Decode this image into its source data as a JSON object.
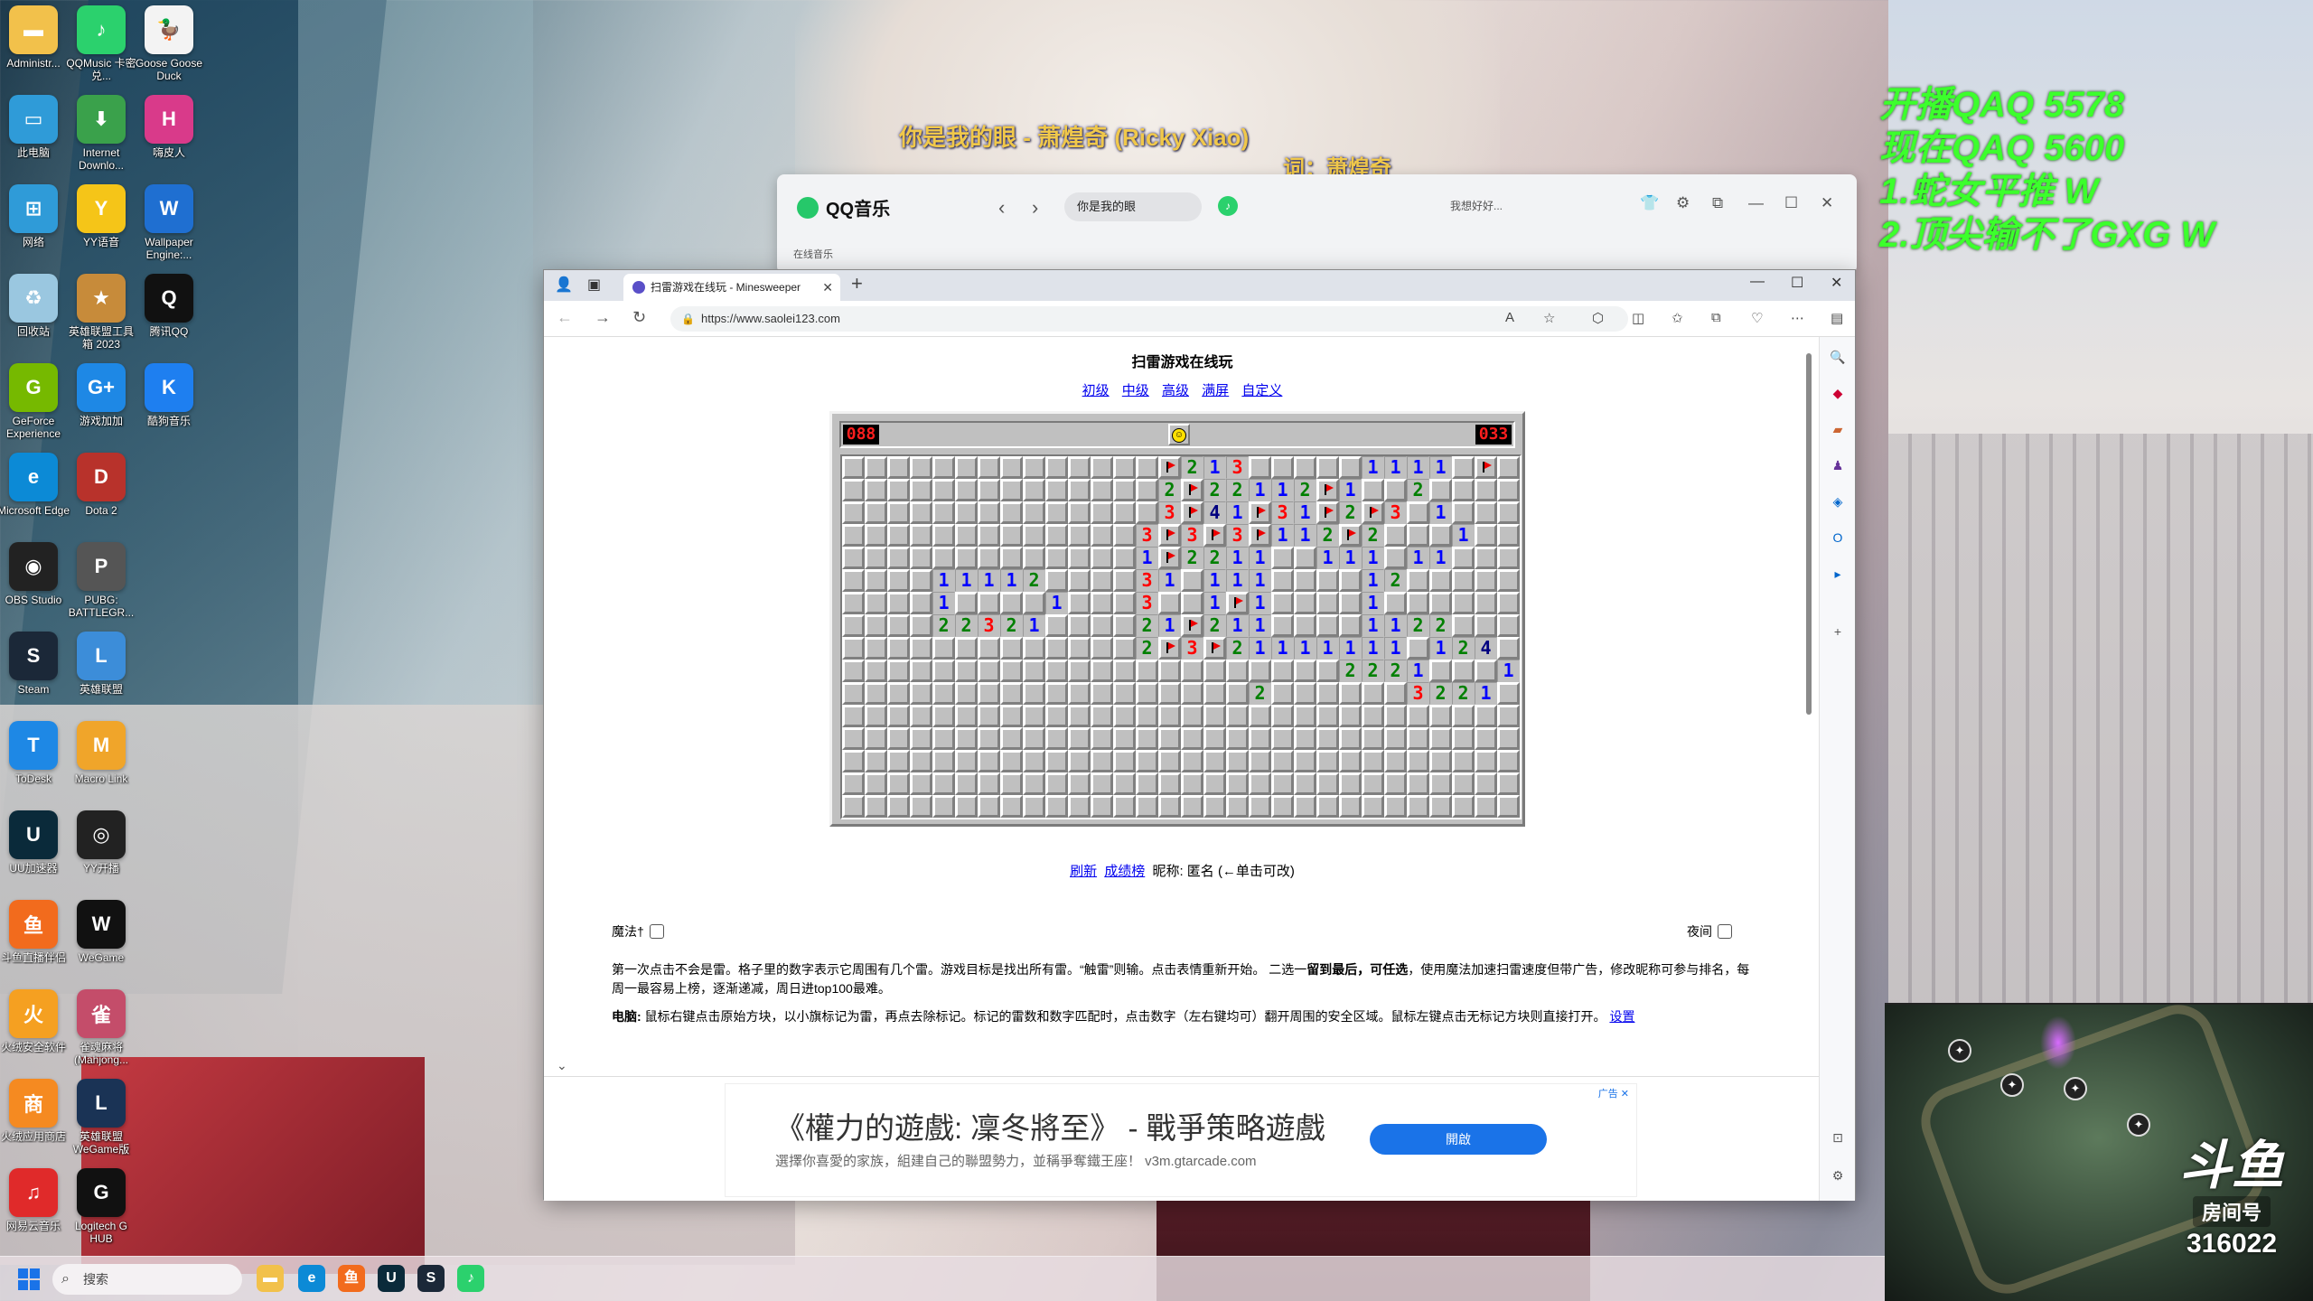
{
  "desktop": {
    "icons": [
      {
        "label": "Administr...",
        "icon": "folder-icon",
        "color": "#f2c14b",
        "glyph": "▬"
      },
      {
        "label": "QQMusic 卡密兑...",
        "icon": "qqmusic-icon",
        "color": "#2bd16d",
        "glyph": "♪"
      },
      {
        "label": "Goose Goose Duck",
        "icon": "goose-icon",
        "color": "#f3f3f3",
        "glyph": "🦆"
      },
      {
        "label": "此电脑",
        "icon": "computer-icon",
        "color": "#2f9bd8",
        "glyph": "▭"
      },
      {
        "label": "Internet Downlo...",
        "icon": "idm-icon",
        "color": "#3aa14b",
        "glyph": "⬇"
      },
      {
        "label": "嗨皮人",
        "icon": "game-icon",
        "color": "#d93a8a",
        "glyph": "H"
      },
      {
        "label": "网络",
        "icon": "network-icon",
        "color": "#2f9bd8",
        "glyph": "⊞"
      },
      {
        "label": "YY语音",
        "icon": "yy-icon",
        "color": "#f5c518",
        "glyph": "Y"
      },
      {
        "label": "Wallpaper Engine:...",
        "icon": "wallpaper-engine-icon",
        "color": "#1f6fd1",
        "glyph": "W"
      },
      {
        "label": "回收站",
        "icon": "recycle-bin-icon",
        "color": "#9ac7e0",
        "glyph": "♻"
      },
      {
        "label": "英雄联盟工具箱 2023",
        "icon": "lol-toolbox-icon",
        "color": "#c78b3a",
        "glyph": "★"
      },
      {
        "label": "腾讯QQ",
        "icon": "qq-icon",
        "color": "#111111",
        "glyph": "Q"
      },
      {
        "label": "GeForce Experience",
        "icon": "geforce-icon",
        "color": "#76b900",
        "glyph": "G"
      },
      {
        "label": "游戏加加",
        "icon": "game-plus-icon",
        "color": "#1e88e5",
        "glyph": "G+"
      },
      {
        "label": "酷狗音乐",
        "icon": "kugou-icon",
        "color": "#1e7ff0",
        "glyph": "K"
      },
      {
        "label": "Microsoft Edge",
        "icon": "edge-icon",
        "color": "#0c8ad6",
        "glyph": "e"
      },
      {
        "label": "Dota 2",
        "icon": "dota-icon",
        "color": "#b8322b",
        "glyph": "D"
      },
      {
        "label": "",
        "icon": "blank",
        "color": "transparent",
        "glyph": ""
      },
      {
        "label": "OBS Studio",
        "icon": "obs-icon",
        "color": "#222222",
        "glyph": "◉"
      },
      {
        "label": "PUBG: BATTLEGR...",
        "icon": "pubg-icon",
        "color": "#555555",
        "glyph": "P"
      },
      {
        "label": "",
        "icon": "blank",
        "color": "transparent",
        "glyph": ""
      },
      {
        "label": "Steam",
        "icon": "steam-icon",
        "color": "#1b2838",
        "glyph": "S"
      },
      {
        "label": "英雄联盟",
        "icon": "lol-icon",
        "color": "#3c8dd9",
        "glyph": "L"
      },
      {
        "label": "",
        "icon": "blank",
        "color": "transparent",
        "glyph": ""
      },
      {
        "label": "ToDesk",
        "icon": "todesk-icon",
        "color": "#1e88e5",
        "glyph": "T"
      },
      {
        "label": "Macro Link",
        "icon": "macro-icon",
        "color": "#f0a52a",
        "glyph": "M"
      },
      {
        "label": "",
        "icon": "blank",
        "color": "transparent",
        "glyph": ""
      },
      {
        "label": "UU加速器",
        "icon": "uu-icon",
        "color": "#0a2a3a",
        "glyph": "U"
      },
      {
        "label": "YY开播",
        "icon": "yy-live-icon",
        "color": "#222222",
        "glyph": "◎"
      },
      {
        "label": "",
        "icon": "blank",
        "color": "transparent",
        "glyph": ""
      },
      {
        "label": "斗鱼直播伴侣",
        "icon": "douyu-icon",
        "color": "#f26b1d",
        "glyph": "鱼"
      },
      {
        "label": "WeGame",
        "icon": "wegame-icon",
        "color": "#111111",
        "glyph": "W"
      },
      {
        "label": "",
        "icon": "blank",
        "color": "transparent",
        "glyph": ""
      },
      {
        "label": "火绒安全软件",
        "icon": "huorong-icon",
        "color": "#f5a021",
        "glyph": "火"
      },
      {
        "label": "雀魂麻将 (Mahjong...",
        "icon": "mahjong-icon",
        "color": "#c44d6a",
        "glyph": "雀"
      },
      {
        "label": "",
        "icon": "blank",
        "color": "transparent",
        "glyph": ""
      },
      {
        "label": "火绒应用商店",
        "icon": "store-icon",
        "color": "#f58a21",
        "glyph": "商"
      },
      {
        "label": "英雄联盟 WeGame版",
        "icon": "lol-wegame-icon",
        "color": "#1a3355",
        "glyph": "L"
      },
      {
        "label": "",
        "icon": "blank",
        "color": "transparent",
        "glyph": ""
      },
      {
        "label": "网易云音乐",
        "icon": "netease-icon",
        "color": "#e02a2a",
        "glyph": "♫"
      },
      {
        "label": "Logitech G HUB",
        "icon": "ghub-icon",
        "color": "#111111",
        "glyph": "G"
      }
    ]
  },
  "lyrics": {
    "line1": "你是我的眼 - 萧煌奇 (Ricky Xiao)",
    "line2": "词：萧煌奇"
  },
  "stream_overlay": {
    "lines": [
      "开播QAQ 5578",
      "现在QAQ 5600",
      "1.蛇女平推 W",
      "2.顶尖输不了GXG W"
    ]
  },
  "qqmusic": {
    "title": "QQ音乐",
    "search_value": "你是我的眼",
    "user": "我想好好...",
    "subnav": "在线音乐"
  },
  "browser": {
    "tab_title": "扫雷游戏在线玩 - Minesweeper",
    "url": "https://www.saolei123.com"
  },
  "page": {
    "title": "扫雷游戏在线玩",
    "levels": [
      "初级",
      "中级",
      "高级",
      "满屏",
      "自定义"
    ],
    "mine_counter": "088",
    "timer": "033",
    "face": "☺",
    "link_refresh": "刷新",
    "link_scores": "成绩榜",
    "nickname_text": "昵称: 匿名 (←单击可改)",
    "magic_label": "魔法†",
    "night_label": "夜间",
    "desc_1a": "第一次点击不会是雷。格子里的数字表示它周围有几个雷。游戏目标是找出所有雷。“触雷”则输。点击表情重新开始。 二选一",
    "desc_1b": "留到最后，可任选",
    "desc_1c": "，使用魔法加速扫雷速度但带广告，修改昵称可参与排名，每周一最容易上榜，逐渐递减，周日进top100最难。",
    "desc_2a": "电脑:",
    "desc_2b": " 鼠标右键点击原始方块，以小旗标记为雷，再点去除标记。标记的雷数和数字匹配时，点击数字（左右键均可）翻开周围的安全区域。鼠标左键点击无标记方块则直接打开。",
    "settings_link": "设置"
  },
  "ad": {
    "title": "《權力的遊戲: 凜冬將至》 - 戰爭策略遊戲",
    "subtitle": "選擇你喜愛的家族，組建自己的聯盟勢力，並稱爭奪鐵王座！ v3m.gtarcade.com",
    "button": "開啟",
    "mark": "广告 ✕"
  },
  "minesweeper": {
    "cols": 30,
    "rows": 16,
    "cells": [
      "..............#213.....1111.#.",
      "..............2#22112#1..2....",
      "..............3#41#31#2#3.1...",
      ".............3#3#3#112#2...1..",
      ".............1#2211..111.11...",
      "....11112....31.111....12.....",
      "....1....1...3..1#1....1......",
      "....22321....21#211....1122...",
      ".............2#3#21111111.124.",
      "......................2221...1",
      "..................2......3221.",
      "..............................",
      "..............................",
      "..............................",
      "..............................",
      ".............................."
    ]
  },
  "douyu": {
    "logo": "斗鱼",
    "room_label": "房间号",
    "room_number": "316022"
  },
  "taskbar": {
    "search_placeholder": "搜索"
  }
}
